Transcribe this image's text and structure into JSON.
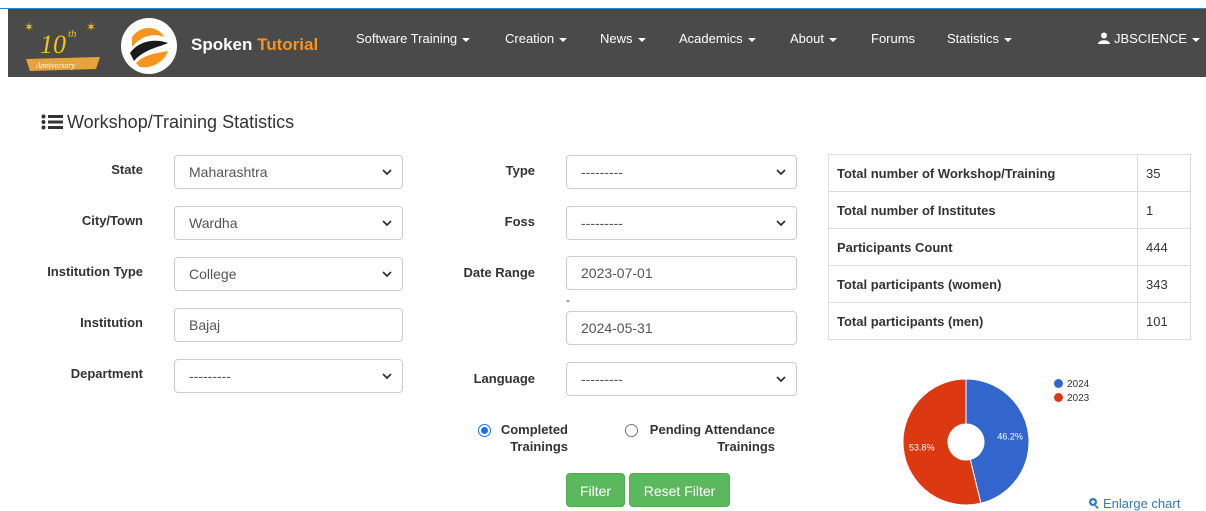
{
  "navbar": {
    "anniversary_number": "10",
    "anniversary_suffix": "th",
    "anniversary_ribbon": "Anniversary",
    "brand_part1": "Spoken ",
    "brand_part2": "Tutorial",
    "items": [
      {
        "label": "Software Training",
        "dropdown": true
      },
      {
        "label": "Creation",
        "dropdown": true
      },
      {
        "label": "News",
        "dropdown": true
      },
      {
        "label": "Academics",
        "dropdown": true
      },
      {
        "label": "About",
        "dropdown": true
      },
      {
        "label": "Forums",
        "dropdown": false
      },
      {
        "label": "Statistics",
        "dropdown": true
      }
    ],
    "user": "JBSCIENCE"
  },
  "page": {
    "title": "Workshop/Training Statistics"
  },
  "filters": {
    "state": {
      "label": "State",
      "value": "Maharashtra"
    },
    "city": {
      "label": "City/Town",
      "value": "Wardha"
    },
    "institution_type": {
      "label": "Institution Type",
      "value": "College"
    },
    "institution": {
      "label": "Institution",
      "value": "Bajaj"
    },
    "department": {
      "label": "Department",
      "value": "---------"
    },
    "type": {
      "label": "Type",
      "value": "---------"
    },
    "foss": {
      "label": "Foss",
      "value": "---------"
    },
    "date_range": {
      "label": "Date Range",
      "from": "2023-07-01",
      "separator": "-",
      "to": "2024-05-31"
    },
    "language": {
      "label": "Language",
      "value": "---------"
    },
    "radio_completed": {
      "line1": "Completed",
      "line2": "Trainings",
      "selected": true
    },
    "radio_pending": {
      "line1": "Pending Attendance",
      "line2": "Trainings",
      "selected": false
    },
    "filter_button": "Filter",
    "reset_button": "Reset Filter"
  },
  "stats": {
    "rows": [
      {
        "label": "Total number of Workshop/Training",
        "value": "35"
      },
      {
        "label": "Total number of Institutes",
        "value": "1"
      },
      {
        "label": "Participants Count",
        "value": "444"
      },
      {
        "label": "Total participants (women)",
        "value": "343"
      },
      {
        "label": "Total participants (men)",
        "value": "101"
      }
    ]
  },
  "chart_data": {
    "type": "pie",
    "categories": [
      "2024",
      "2023"
    ],
    "values": [
      46.2,
      53.8
    ],
    "data_labels": [
      "46.2%",
      "53.8%"
    ],
    "colors": [
      "#3366cc",
      "#dc3912"
    ],
    "legend": "top-right"
  },
  "enlarge_link": "Enlarge chart"
}
